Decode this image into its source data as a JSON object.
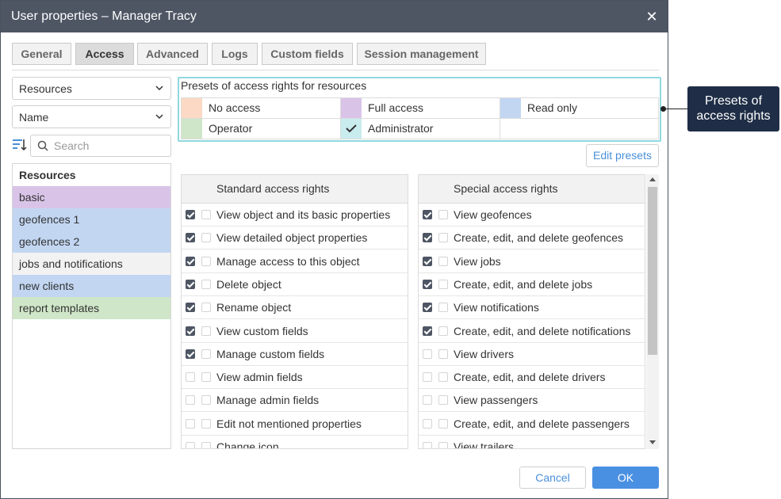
{
  "window": {
    "title": "User properties – Manager Tracy",
    "close_glyph": "✕"
  },
  "tabs": [
    {
      "label": "General",
      "active": false
    },
    {
      "label": "Access",
      "active": true
    },
    {
      "label": "Advanced",
      "active": false
    },
    {
      "label": "Logs",
      "active": false
    },
    {
      "label": "Custom fields",
      "active": false
    },
    {
      "label": "Session management",
      "active": false
    }
  ],
  "left": {
    "type_select": "Resources",
    "sort_select": "Name",
    "search_placeholder": "Search",
    "list_header": "Resources",
    "items": [
      {
        "label": "basic",
        "color": "#d9c4e8"
      },
      {
        "label": "geofences 1",
        "color": "#c2d6f2"
      },
      {
        "label": "geofences 2",
        "color": "#c2d6f2"
      },
      {
        "label": "jobs and notifications",
        "color": "#f2f2f2"
      },
      {
        "label": "new clients",
        "color": "#c2d6f2"
      },
      {
        "label": "report templates",
        "color": "#cfe6c8"
      }
    ]
  },
  "presets": {
    "title": "Presets of access rights for resources",
    "items": [
      {
        "label": "No access",
        "color": "#fcd9c4",
        "checked": false
      },
      {
        "label": "Full access",
        "color": "#d9c4e8",
        "checked": false
      },
      {
        "label": "Read only",
        "color": "#c2d6f2",
        "checked": false
      },
      {
        "label": "Operator",
        "color": "#cfe6c8",
        "checked": false
      },
      {
        "label": "Administrator",
        "color": "#c9ecef",
        "checked": true
      }
    ],
    "edit_button": "Edit presets"
  },
  "standard": {
    "header": "Standard access rights",
    "rows": [
      {
        "label": "View object and its basic properties",
        "checked": true
      },
      {
        "label": "View detailed object properties",
        "checked": true
      },
      {
        "label": "Manage access to this object",
        "checked": true
      },
      {
        "label": "Delete object",
        "checked": true
      },
      {
        "label": "Rename object",
        "checked": true
      },
      {
        "label": "View custom fields",
        "checked": true
      },
      {
        "label": "Manage custom fields",
        "checked": true
      },
      {
        "label": "View admin fields",
        "checked": false
      },
      {
        "label": "Manage admin fields",
        "checked": false
      },
      {
        "label": "Edit not mentioned properties",
        "checked": false
      },
      {
        "label": "Change icon",
        "checked": false
      }
    ]
  },
  "special": {
    "header": "Special access rights",
    "rows": [
      {
        "label": "View geofences",
        "checked": true
      },
      {
        "label": "Create, edit, and delete geofences",
        "checked": true
      },
      {
        "label": "View jobs",
        "checked": true
      },
      {
        "label": "Create, edit, and delete jobs",
        "checked": true
      },
      {
        "label": "View notifications",
        "checked": true
      },
      {
        "label": "Create, edit, and delete notifications",
        "checked": true
      },
      {
        "label": "View drivers",
        "checked": false
      },
      {
        "label": "Create, edit, and delete drivers",
        "checked": false
      },
      {
        "label": "View passengers",
        "checked": false
      },
      {
        "label": "Create, edit, and delete passengers",
        "checked": false
      },
      {
        "label": "View trailers",
        "checked": false
      }
    ]
  },
  "footer": {
    "cancel": "Cancel",
    "ok": "OK"
  },
  "callout": {
    "line1": "Presets of",
    "line2": "access rights"
  }
}
